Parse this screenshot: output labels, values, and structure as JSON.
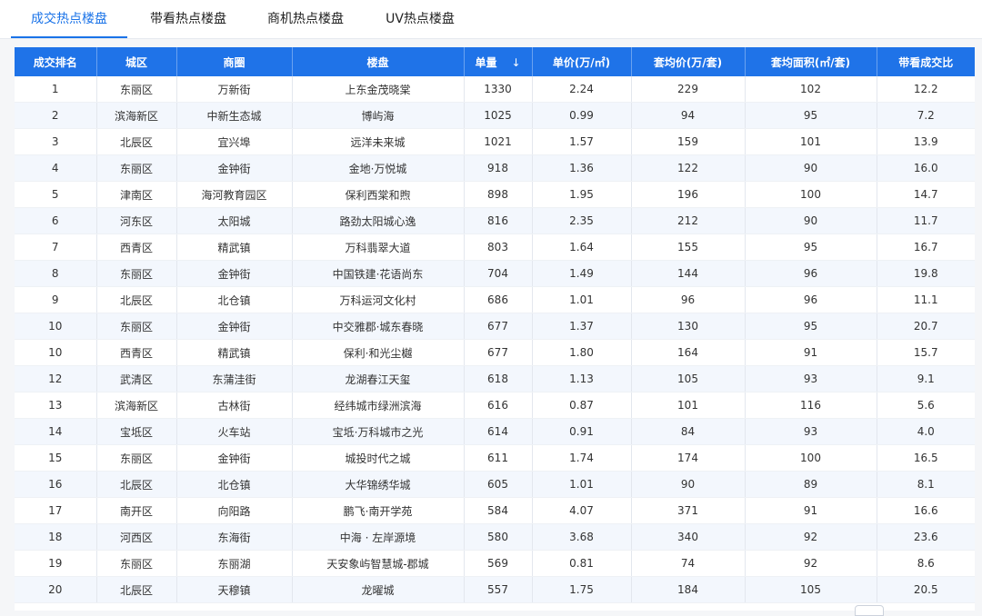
{
  "tabs": [
    {
      "label": "成交热点楼盘",
      "active": true
    },
    {
      "label": "带看热点楼盘",
      "active": false
    },
    {
      "label": "商机热点楼盘",
      "active": false
    },
    {
      "label": "UV热点楼盘",
      "active": false
    }
  ],
  "table": {
    "headers": {
      "rank": "成交排名",
      "district": "城区",
      "area": "商圈",
      "estate": "楼盘",
      "units": "单量",
      "unit_price": "单价(万/㎡)",
      "avg_price": "套均价(万/套)",
      "avg_size": "套均面积(㎡/套)",
      "ratio": "带看成交比"
    },
    "sort_icon": "arrow-down-icon",
    "rows": [
      [
        "1",
        "东丽区",
        "万新街",
        "上东金茂晓棠",
        "1330",
        "2.24",
        "229",
        "102",
        "12.2"
      ],
      [
        "2",
        "滨海新区",
        "中新生态城",
        "博屿海",
        "1025",
        "0.99",
        "94",
        "95",
        "7.2"
      ],
      [
        "3",
        "北辰区",
        "宜兴埠",
        "远洋未来城",
        "1021",
        "1.57",
        "159",
        "101",
        "13.9"
      ],
      [
        "4",
        "东丽区",
        "金钟街",
        "金地·万悦城",
        "918",
        "1.36",
        "122",
        "90",
        "16.0"
      ],
      [
        "5",
        "津南区",
        "海河教育园区",
        "保利西棠和煦",
        "898",
        "1.95",
        "196",
        "100",
        "14.7"
      ],
      [
        "6",
        "河东区",
        "太阳城",
        "路劲太阳城心逸",
        "816",
        "2.35",
        "212",
        "90",
        "11.7"
      ],
      [
        "7",
        "西青区",
        "精武镇",
        "万科翡翠大道",
        "803",
        "1.64",
        "155",
        "95",
        "16.7"
      ],
      [
        "8",
        "东丽区",
        "金钟街",
        "中国铁建·花语尚东",
        "704",
        "1.49",
        "144",
        "96",
        "19.8"
      ],
      [
        "9",
        "北辰区",
        "北仓镇",
        "万科运河文化村",
        "686",
        "1.01",
        "96",
        "96",
        "11.1"
      ],
      [
        "10",
        "东丽区",
        "金钟街",
        "中交雅郡·城东春晓",
        "677",
        "1.37",
        "130",
        "95",
        "20.7"
      ],
      [
        "10",
        "西青区",
        "精武镇",
        "保利·和光尘樾",
        "677",
        "1.80",
        "164",
        "91",
        "15.7"
      ],
      [
        "12",
        "武清区",
        "东蒲洼街",
        "龙湖春江天玺",
        "618",
        "1.13",
        "105",
        "93",
        "9.1"
      ],
      [
        "13",
        "滨海新区",
        "古林街",
        "经纬城市绿洲滨海",
        "616",
        "0.87",
        "101",
        "116",
        "5.6"
      ],
      [
        "14",
        "宝坻区",
        "火车站",
        "宝坻·万科城市之光",
        "614",
        "0.91",
        "84",
        "93",
        "4.0"
      ],
      [
        "15",
        "东丽区",
        "金钟街",
        "城投时代之城",
        "611",
        "1.74",
        "174",
        "100",
        "16.5"
      ],
      [
        "16",
        "北辰区",
        "北仓镇",
        "大华锦绣华城",
        "605",
        "1.01",
        "90",
        "89",
        "8.1"
      ],
      [
        "17",
        "南开区",
        "向阳路",
        "鹏飞·南开学苑",
        "584",
        "4.07",
        "371",
        "91",
        "16.6"
      ],
      [
        "18",
        "河西区",
        "东海街",
        "中海 · 左岸源境",
        "580",
        "3.68",
        "340",
        "92",
        "23.6"
      ],
      [
        "19",
        "东丽区",
        "东丽湖",
        "天安象屿智慧城-郡城",
        "569",
        "0.81",
        "74",
        "92",
        "8.6"
      ],
      [
        "20",
        "北辰区",
        "天穆镇",
        "龙曜城",
        "557",
        "1.75",
        "184",
        "105",
        "20.5"
      ]
    ]
  },
  "colors": {
    "accent": "#1a73e8",
    "header_bg": "#1f73e8",
    "stripe": "#f3f7fd"
  }
}
